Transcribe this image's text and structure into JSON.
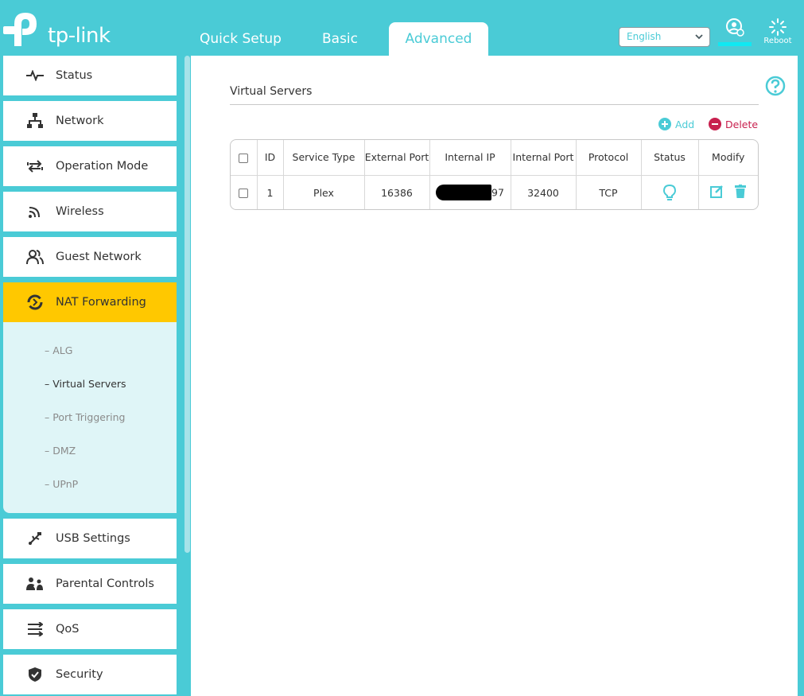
{
  "brand": {
    "name": "tp-link",
    "accent": "#4acbd6",
    "highlight": "#ffc800"
  },
  "tabs": [
    {
      "label": "Quick Setup"
    },
    {
      "label": "Basic"
    },
    {
      "label": "Advanced",
      "active": true
    }
  ],
  "header": {
    "language": "English",
    "logout_label": "",
    "reboot_label": "Reboot"
  },
  "sidebar": {
    "items": [
      {
        "label": "Status",
        "icon": "pulse-icon"
      },
      {
        "label": "Network",
        "icon": "network-icon"
      },
      {
        "label": "Operation Mode",
        "icon": "swap-icon"
      },
      {
        "label": "Wireless",
        "icon": "wifi-icon"
      },
      {
        "label": "Guest Network",
        "icon": "users-icon"
      },
      {
        "label": "NAT Forwarding",
        "icon": "nat-icon",
        "active": true
      },
      {
        "label": "USB Settings",
        "icon": "usb-icon"
      },
      {
        "label": "Parental Controls",
        "icon": "parental-icon"
      },
      {
        "label": "QoS",
        "icon": "qos-icon"
      },
      {
        "label": "Security",
        "icon": "shield-icon"
      }
    ],
    "nat_submenu": [
      {
        "label": "ALG"
      },
      {
        "label": "Virtual Servers",
        "current": true
      },
      {
        "label": "Port Triggering"
      },
      {
        "label": "DMZ"
      },
      {
        "label": "UPnP"
      }
    ]
  },
  "main": {
    "title": "Virtual Servers",
    "add_label": "Add",
    "delete_label": "Delete",
    "table": {
      "columns": [
        "ID",
        "Service Type",
        "External Port",
        "Internal IP",
        "Internal Port",
        "Protocol",
        "Status",
        "Modify"
      ],
      "rows": [
        {
          "id": "1",
          "service_type": "Plex",
          "external_port": "16386",
          "internal_ip_tail": "97",
          "internal_port": "32400",
          "protocol": "TCP",
          "status": "enabled"
        }
      ]
    }
  }
}
